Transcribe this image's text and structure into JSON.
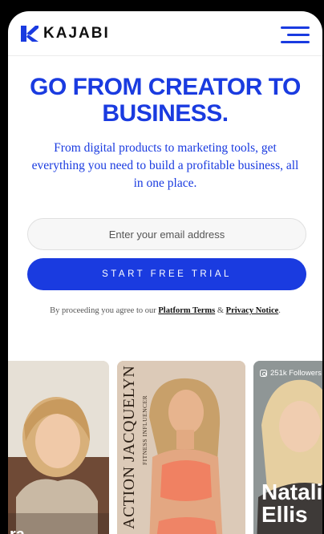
{
  "header": {
    "brand": "KAJABI",
    "menu_icon": "hamburger-menu-icon",
    "accent": "#1a3be0"
  },
  "hero": {
    "title": "GO FROM CREATOR TO BUSINESS.",
    "subtitle": "From digital products to marketing tools, get everything you need to build a profitable business, all in one place."
  },
  "signup": {
    "email_placeholder": "Enter your email address",
    "cta_label": "START FREE TRIAL",
    "legal_prefix": "By proceeding you agree to our ",
    "platform_terms": "Platform Terms",
    "legal_and": " & ",
    "privacy_notice": "Privacy Notice",
    "legal_suffix": "."
  },
  "cards": [
    {
      "name_fragment": "ra"
    },
    {
      "title": "ACTION JACQUELYN",
      "subtitle": "FITNESS INFLUENCER"
    },
    {
      "followers": "251k Followers",
      "name": "Natali Ellis"
    }
  ]
}
